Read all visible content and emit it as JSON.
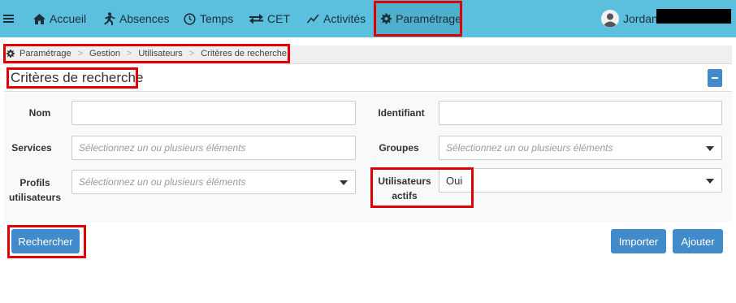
{
  "nav": {
    "menu_icon": "hamburger-icon",
    "items": [
      {
        "label": "Accueil",
        "icon": "home-icon"
      },
      {
        "label": "Absences",
        "icon": "running-icon"
      },
      {
        "label": "Temps",
        "icon": "clock-icon"
      },
      {
        "label": "CET",
        "icon": "transfer-arrows-icon"
      },
      {
        "label": "Activités",
        "icon": "line-chart-icon"
      },
      {
        "label": "Paramétrage",
        "icon": "gear-icon",
        "active": true
      }
    ],
    "user": {
      "name": "Jordan",
      "avatar_icon": "user-avatar-icon"
    }
  },
  "breadcrumb": [
    "Paramétrage",
    "Gestion",
    "Utilisateurs",
    "Critères de recherche"
  ],
  "panel": {
    "title": "Critères de recherche"
  },
  "form": {
    "nom_label": "Nom",
    "identifiant_label": "Identifiant",
    "services_label": "Services",
    "services_placeholder": "Sélectionnez un ou plusieurs éléments",
    "groupes_label": "Groupes",
    "groupes_placeholder": "Sélectionnez un ou plusieurs éléments",
    "profils_label_1": "Profils",
    "profils_label_2": "utilisateurs",
    "profils_placeholder": "Sélectionnez un ou plusieurs éléments",
    "actifs_label_1": "Utilisateurs",
    "actifs_label_2": "actifs",
    "actifs_value": "Oui"
  },
  "buttons": {
    "search": "Rechercher",
    "import": "Importer",
    "add": "Ajouter"
  },
  "colors": {
    "topbar": "#5bc0de",
    "primary": "#428bca",
    "highlight": "#e00000"
  }
}
